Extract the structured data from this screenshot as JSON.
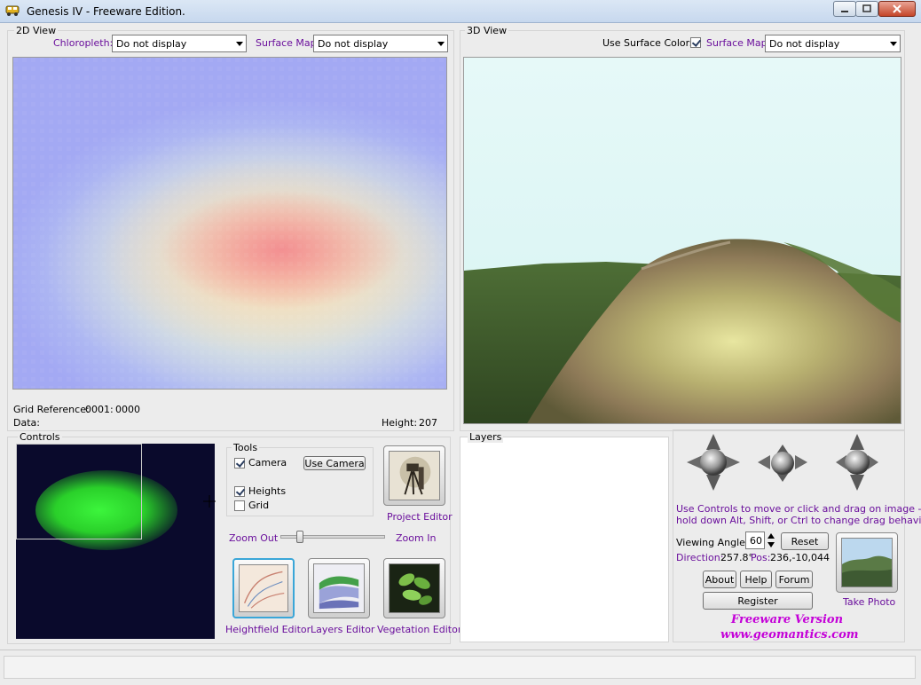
{
  "window": {
    "title": "Genesis IV - Freeware Edition."
  },
  "view2d": {
    "group_title": "2D View",
    "chloropleth_label": "Chloropleth:",
    "chloropleth_value": "Do not display",
    "surface_map_label": "Surface Map:",
    "surface_map_value": "Do not display",
    "grid_reference_label": "Grid Reference:",
    "grid_reference_x": "0001:",
    "grid_reference_y": "0000",
    "data_label": "Data:",
    "height_label": "Height:",
    "height_value": "207"
  },
  "view3d": {
    "group_title": "3D View",
    "use_surface_colors_label": "Use Surface Colors",
    "use_surface_colors_checked": true,
    "surface_map_label": "Surface Map:",
    "surface_map_value": "Do not display"
  },
  "controls": {
    "group_title": "Controls"
  },
  "tools": {
    "group_title": "Tools",
    "camera_label": "Camera",
    "camera_checked": true,
    "use_camera_button": "Use Camera",
    "heights_label": "Heights",
    "heights_checked": true,
    "grid_label": "Grid",
    "grid_checked": false,
    "project_editor_label": "Project Editor",
    "zoom_out_label": "Zoom Out",
    "zoom_in_label": "Zoom In",
    "heightfield_editor_label": "Heightfield Editor",
    "layers_editor_label": "Layers Editor",
    "vegetation_editor_label": "Vegetation Editor"
  },
  "layers": {
    "group_title": "Layers"
  },
  "navigation": {
    "help_text_line1": "Use Controls to move or click and drag on image -",
    "help_text_line2": "hold down Alt, Shift, or Ctrl to change drag behaviour.",
    "viewing_angle_label": "Viewing Angle:",
    "viewing_angle_value": "60",
    "reset_button": "Reset",
    "direction_label": "Direction:",
    "direction_value": "257.8°",
    "pos_label": "Pos:",
    "pos_value": "236,-10,044",
    "about_button": "About",
    "help_button": "Help",
    "forum_button": "Forum",
    "register_button": "Register",
    "take_photo_label": "Take Photo",
    "freeware_line1": "Freeware Version",
    "freeware_line2": "www.geomantics.com"
  },
  "colors": {
    "label_purple": "#6a0f9c",
    "freeware_magenta": "#c400d8"
  }
}
